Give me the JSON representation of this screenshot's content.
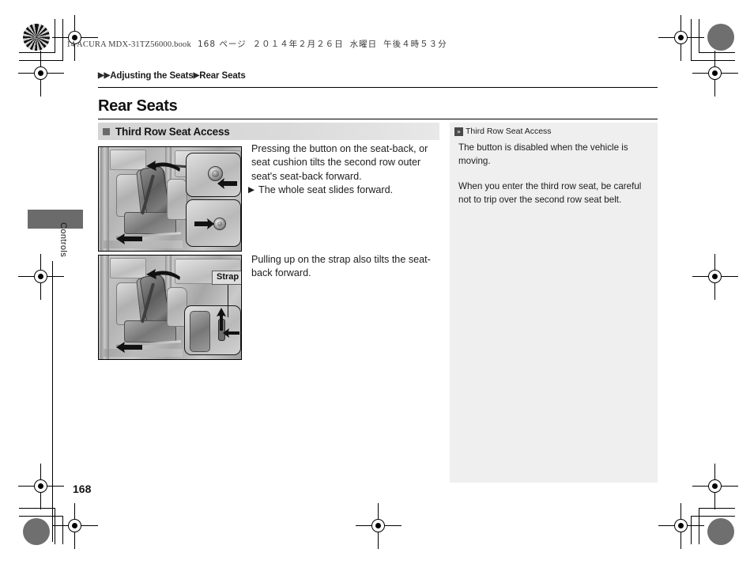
{
  "print_header": {
    "book_file": "14 ACURA MDX-31TZ56000.book",
    "page_marker": "168 ページ",
    "date_jp": "２０１４年２月２６日",
    "weekday_jp": "水曜日",
    "time_jp": "午後４時５３分"
  },
  "breadcrumb": {
    "arrow_glyph": "▶",
    "level1": "Adjusting the Seats",
    "level2": "Rear Seats"
  },
  "page_title": "Rear Seats",
  "subsection": {
    "bullet_icon": "filled-square",
    "title": "Third Row Seat Access"
  },
  "body": {
    "paragraph1": "Pressing the button on the seat-back, or seat cushion tilts the second row outer seat's seat-back forward.",
    "bullet_arrow": "▶",
    "bullet1": "The whole seat slides forward.",
    "paragraph2": "Pulling up on the strap also tilts the seat-back forward."
  },
  "figures": [
    {
      "name": "second-row-seat-button-illustration",
      "caption": "",
      "insets": [
        "seat-back button close-up",
        "seat cushion button close-up"
      ]
    },
    {
      "name": "second-row-seat-strap-illustration",
      "callout_label": "Strap",
      "insets": [
        "strap pull close-up"
      ]
    }
  ],
  "note_panel": {
    "badge_glyph": "»",
    "title": "Third Row Seat Access",
    "paragraphs": [
      "The button is disabled when the vehicle is moving.",
      "When you enter the third row seat, be careful not to trip over the second row seat belt."
    ]
  },
  "chapter_tab": {
    "label": "Controls"
  },
  "page_number": "168",
  "colors": {
    "subhead_bar": "#dadada",
    "subhead_square": "#6a6a6a",
    "note_panel_bg": "#efeff0",
    "chapter_tab": "#6b6b6b",
    "text": "#1d1d1d"
  }
}
